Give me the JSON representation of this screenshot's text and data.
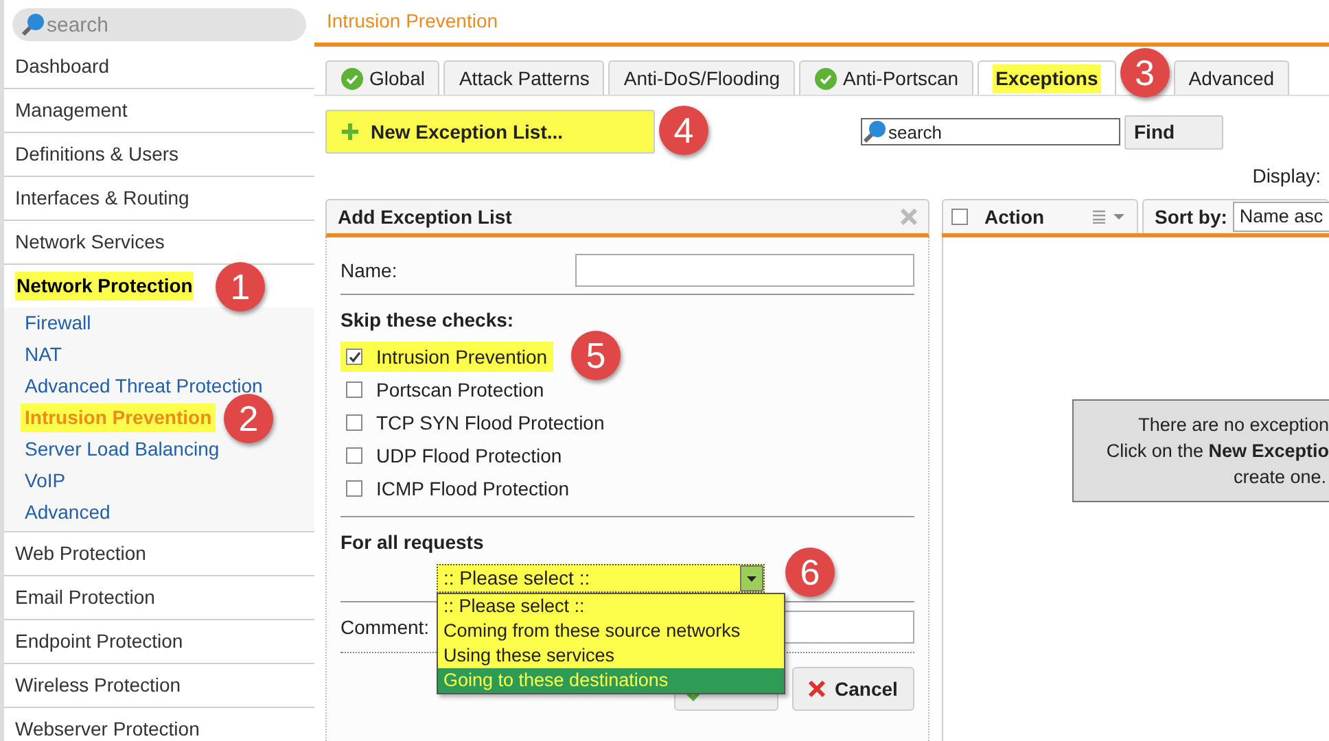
{
  "search": {
    "placeholder": "search"
  },
  "page_title": "Intrusion Prevention",
  "sidebar": {
    "items": [
      {
        "label": "Dashboard",
        "selected": false
      },
      {
        "label": "Management",
        "selected": false
      },
      {
        "label": "Definitions & Users",
        "selected": false
      },
      {
        "label": "Interfaces & Routing",
        "selected": false
      },
      {
        "label": "Network Services",
        "selected": false
      },
      {
        "label": "Network Protection",
        "selected": true,
        "badge": "1",
        "children": [
          {
            "label": "Firewall",
            "selected": false
          },
          {
            "label": "NAT",
            "selected": false
          },
          {
            "label": "Advanced Threat Protection",
            "selected": false
          },
          {
            "label": "Intrusion Prevention",
            "selected": true,
            "badge": "2"
          },
          {
            "label": "Server Load Balancing",
            "selected": false
          },
          {
            "label": "VoIP",
            "selected": false
          },
          {
            "label": "Advanced",
            "selected": false
          }
        ]
      },
      {
        "label": "Web Protection",
        "selected": false
      },
      {
        "label": "Email Protection",
        "selected": false
      },
      {
        "label": "Endpoint Protection",
        "selected": false
      },
      {
        "label": "Wireless Protection",
        "selected": false
      },
      {
        "label": "Webserver Protection",
        "selected": false
      }
    ]
  },
  "tabs": [
    {
      "label": "Global",
      "ok": true,
      "selected": false
    },
    {
      "label": "Attack Patterns",
      "ok": false,
      "selected": false
    },
    {
      "label": "Anti-DoS/Flooding",
      "ok": false,
      "selected": false
    },
    {
      "label": "Anti-Portscan",
      "ok": true,
      "selected": false
    },
    {
      "label": "Exceptions",
      "ok": false,
      "selected": true,
      "badge": "3"
    },
    {
      "label": "Advanced",
      "ok": false,
      "selected": false
    }
  ],
  "new_button": {
    "label": "New Exception List...",
    "highlighted": true,
    "badge": "4"
  },
  "find": {
    "placeholder": "search",
    "button": "Find"
  },
  "display_label": "Display:",
  "form": {
    "title": "Add Exception List",
    "name_label": "Name:",
    "skip_heading": "Skip these checks:",
    "checks": [
      {
        "label": "Intrusion Prevention",
        "checked": true,
        "highlighted": true,
        "badge": "5"
      },
      {
        "label": "Portscan Protection",
        "checked": false,
        "highlighted": false
      },
      {
        "label": "TCP SYN Flood Protection",
        "checked": false,
        "highlighted": false
      },
      {
        "label": "UDP Flood Protection",
        "checked": false,
        "highlighted": false
      },
      {
        "label": "ICMP Flood Protection",
        "checked": false,
        "highlighted": false
      }
    ],
    "requests_heading": "For all requests",
    "select": {
      "value": ":: Please select ::",
      "highlighted": true,
      "badge": "6",
      "expanded": true,
      "options": [
        {
          "label": ":: Please select ::",
          "highlighted": false
        },
        {
          "label": "Coming from these source networks",
          "highlighted": false
        },
        {
          "label": "Using these services",
          "highlighted": false
        },
        {
          "label": "Going to these destinations",
          "highlighted": true
        }
      ]
    },
    "comment_label": "Comment:",
    "cancel": "Cancel"
  },
  "list": {
    "select_all": {
      "checked": false
    },
    "column": "Action",
    "sort_label": "Sort by:",
    "sort_value": "Name asc",
    "empty": [
      "There are no exception",
      "Click on the **New Exceptio**",
      "create one."
    ]
  }
}
